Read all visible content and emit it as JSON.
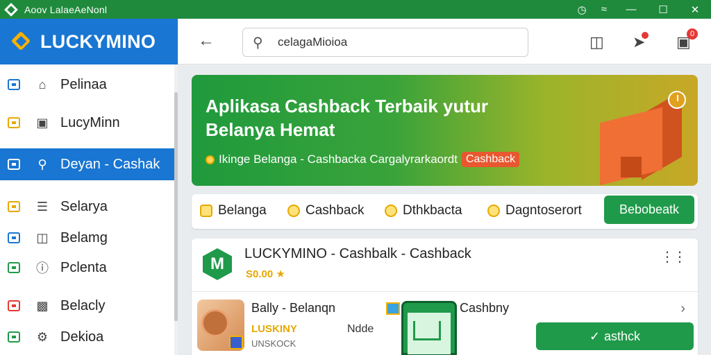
{
  "window": {
    "title": "Aoov LalaeAeNonl"
  },
  "sidebar": {
    "brand": "LUCKYMINO",
    "items": [
      {
        "label": "Pelinaa",
        "icon": "home-icon",
        "accent": "#1976d2"
      },
      {
        "label": "LucyMinn",
        "icon": "briefcase-icon",
        "accent": "#e6a800"
      },
      {
        "label": "Deyan - Cashak",
        "icon": "search-icon",
        "accent": "#1976d2",
        "active": true
      },
      {
        "label": "Selarya",
        "icon": "list-icon",
        "accent": "#e6a800"
      },
      {
        "label": "Belamg",
        "icon": "document-icon",
        "accent": "#1976d2"
      },
      {
        "label": "Pclenta",
        "icon": "info-icon",
        "accent": "#1f9a4a"
      },
      {
        "label": "Belacly",
        "icon": "puzzle-icon",
        "accent": "#e53935"
      },
      {
        "label": "Dekioa",
        "icon": "gear-icon",
        "accent": "#1f9a4a"
      }
    ]
  },
  "search": {
    "value": "celagaMioioa"
  },
  "topbar": {
    "notification_count": "0"
  },
  "hero": {
    "title_line1": "Aplikasa Cashback Terbaik yutur",
    "title_line2": "Belanya Hemat",
    "subtitle": "Ikinge Belanga - Cashbacka Cargalyrarkaordt",
    "chip": "Cashback"
  },
  "categories": [
    {
      "label": "Belanga"
    },
    {
      "label": "Cashback"
    },
    {
      "label": "Dthkbacta"
    },
    {
      "label": "Dagntoserort"
    }
  ],
  "category_cta": "Bebobeatk",
  "app_card": {
    "title": "LUCKYMINO - Cashbalk - Cashback",
    "logo_letter": "M",
    "rating": "S0.00 ★",
    "product": {
      "name": "Bally - Belanqn",
      "brand": "LUSKINY",
      "stock": "UNSKOCK",
      "node": "Ndde",
      "right_label": "Cashbny"
    },
    "cta": "asthck"
  },
  "colors": {
    "titlebar": "#1f8a3c",
    "brand": "#1976d2",
    "accent_green": "#1f9a4a",
    "accent_orange": "#e8572f"
  }
}
